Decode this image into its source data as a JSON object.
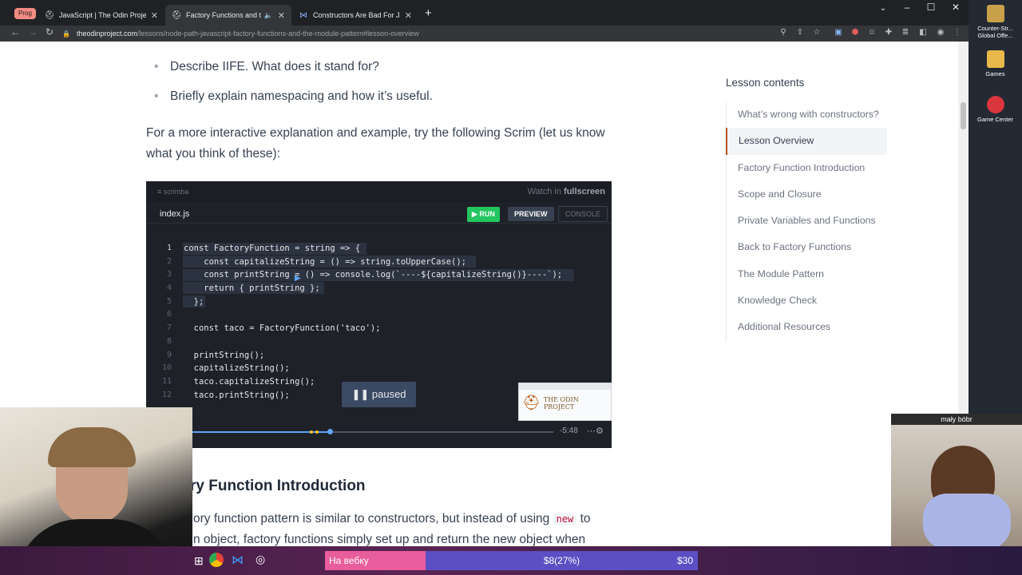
{
  "browser": {
    "tab_group": "Prog",
    "tabs": [
      {
        "title": "JavaScript | The Odin Project",
        "favicon": "odin-helmet-icon"
      },
      {
        "title": "Factory Functions and the Module Pattern",
        "favicon": "odin-helmet-icon",
        "active": true
      },
      {
        "title": "Constructors Are Bad For JavaScript",
        "favicon": "medium-icon"
      }
    ],
    "new_tab": "+",
    "url_host": "theodinproject.com",
    "url_path": "/lessons/node-path-javascript-factory-functions-and-the-module-pattern#lesson-overview"
  },
  "lesson": {
    "bullets": [
      "Describe IIFE. What does it stand for?",
      "Briefly explain namespacing and how it’s useful."
    ],
    "paragraph": "For a more interactive explanation and example, try the following Scrim (let us know what you think of these):",
    "next_heading": "ry Function Introduction",
    "next_text_1a": "ory function pattern is similar to constructors, but instead of using",
    "next_code": "new",
    "next_text_1b": "to",
    "next_text_2": "n object, factory functions simply set up and return the new object when"
  },
  "toc": {
    "title": "Lesson contents",
    "items": [
      "What’s wrong with constructors?",
      "Lesson Overview",
      "Factory Function Introduction",
      "Scope and Closure",
      "Private Variables and Functions",
      "Back to Factory Functions",
      "The Module Pattern",
      "Knowledge Check",
      "Additional Resources"
    ],
    "active_index": 1
  },
  "scrim": {
    "brand": "scrimba",
    "watch_prefix": "Watch in ",
    "watch_fs": "fullscreen",
    "filename": "index.js",
    "run": "RUN",
    "preview": "PREVIEW",
    "console": "CONSOLE",
    "paused": "paused",
    "time": "-5:48",
    "progress": 0.39,
    "thumb_title": "THE ODIN PROJECT",
    "lines": [
      {
        "n": "1",
        "code": "const FactoryFunction = string => {"
      },
      {
        "n": "2",
        "code": "    const capitalizeString = () => string.toUpperCase();"
      },
      {
        "n": "3",
        "code": "    const printString = () => console.log(`----${capitalizeString()}----`);"
      },
      {
        "n": "4",
        "code": "    return { printString };"
      },
      {
        "n": "5",
        "code": "  };"
      },
      {
        "n": "6",
        "code": ""
      },
      {
        "n": "7",
        "code": "  const taco = FactoryFunction('taco');"
      },
      {
        "n": "8",
        "code": ""
      },
      {
        "n": "9",
        "code": "  printString();"
      },
      {
        "n": "10",
        "code": "  capitalizeString();"
      },
      {
        "n": "11",
        "code": "  taco.capitalizeString();"
      },
      {
        "n": "12",
        "code": "  taco.printString();"
      }
    ]
  },
  "overlay": {
    "beaver_label": "mały bóbr"
  },
  "desktop": [
    {
      "label": "Counter-Str... Global Offe...",
      "color": "#c8a04a"
    },
    {
      "label": "Games",
      "color": "#e8b84a"
    },
    {
      "label": "Game Center",
      "color": "#d9363e"
    }
  ],
  "taskbar": {
    "webcam_label": "На вебку",
    "goal_progress": "$8(27%)",
    "goal_target": "$30"
  }
}
